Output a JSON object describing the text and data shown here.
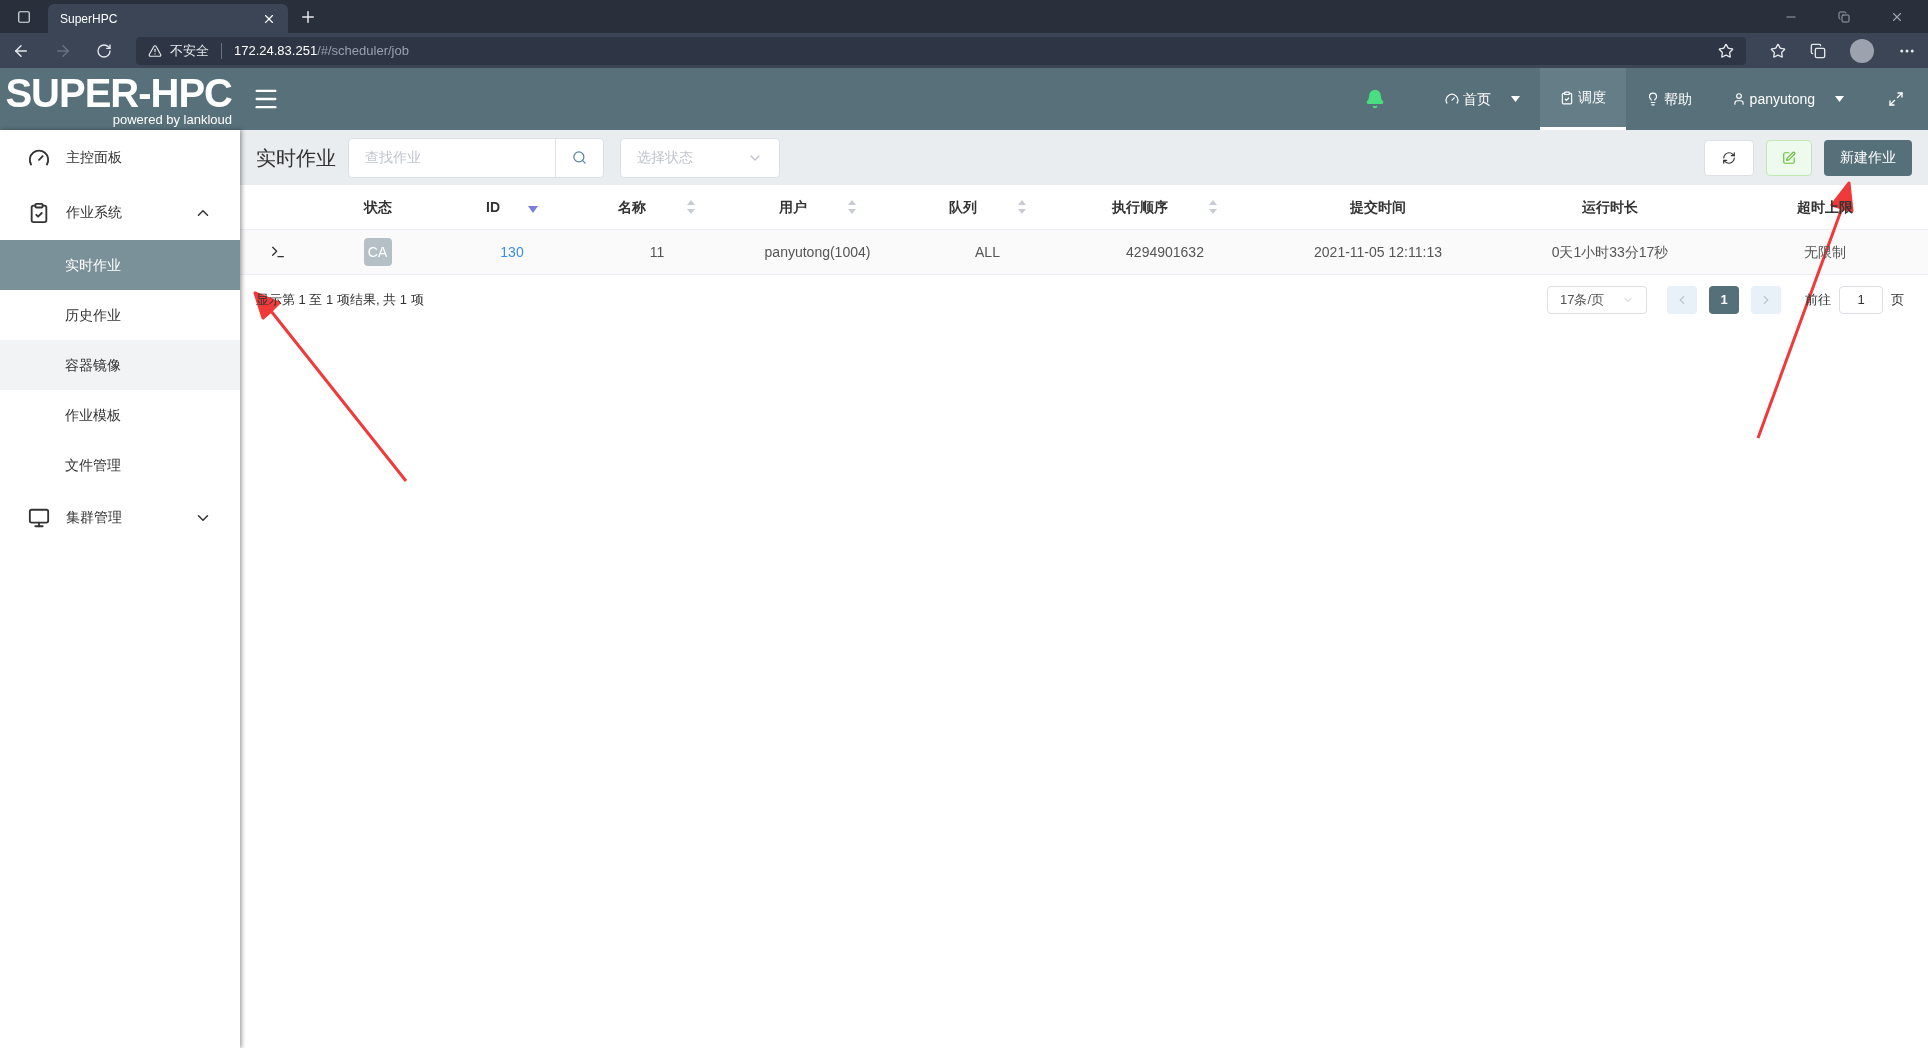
{
  "browser": {
    "tab_title": "SuperHPC",
    "security_label": "不安全",
    "url_host": "172.24.83.251",
    "url_path": "/#/scheduler/job"
  },
  "header": {
    "logo": "SUPER-HPC",
    "logo_sub": "powered by lankloud",
    "nav": [
      {
        "kind": "home",
        "label": "首页",
        "dropdown": true,
        "selected": false
      },
      {
        "kind": "schedule",
        "label": "调度",
        "dropdown": false,
        "selected": true
      },
      {
        "kind": "help",
        "label": "帮助",
        "dropdown": false,
        "selected": false
      },
      {
        "kind": "user",
        "label": "panyutong",
        "dropdown": true,
        "selected": false
      }
    ]
  },
  "sidebar": {
    "items": [
      {
        "kind": "dashboard",
        "label": "主控面板"
      },
      {
        "kind": "jobs",
        "label": "作业系统",
        "expanded": true,
        "children": [
          {
            "label": "实时作业",
            "selected": true,
            "hovered": false
          },
          {
            "label": "历史作业",
            "selected": false,
            "hovered": false
          },
          {
            "label": "容器镜像",
            "selected": false,
            "hovered": true
          },
          {
            "label": "作业模板",
            "selected": false,
            "hovered": false
          },
          {
            "label": "文件管理",
            "selected": false,
            "hovered": false
          }
        ]
      },
      {
        "kind": "cluster",
        "label": "集群管理",
        "expanded": false
      }
    ]
  },
  "toolbar": {
    "title": "实时作业",
    "search": {
      "placeholder": "查找作业"
    },
    "status_select": {
      "placeholder": "选择状态"
    },
    "new_button": "新建作业"
  },
  "table": {
    "columns": [
      {
        "label": "状态",
        "sortable": false
      },
      {
        "label": "ID",
        "sortable": true,
        "sorted_desc": true
      },
      {
        "label": "名称",
        "sortable": true,
        "sorted_desc": false
      },
      {
        "label": "用户",
        "sortable": true,
        "sorted_desc": false
      },
      {
        "label": "队列",
        "sortable": true,
        "sorted_desc": false
      },
      {
        "label": "执行顺序",
        "sortable": true,
        "sorted_desc": false
      },
      {
        "label": "提交时间",
        "sortable": false
      },
      {
        "label": "运行时长",
        "sortable": false
      },
      {
        "label": "超时上限",
        "sortable": false
      }
    ],
    "rows": [
      {
        "status": "CA",
        "id": "130",
        "name": "11",
        "user": "panyutong(1004)",
        "queue": "ALL",
        "order": "4294901632",
        "submitted": "2021-11-05 12:11:13",
        "runtime": "0天1小时33分17秒",
        "timeout": "无限制"
      }
    ]
  },
  "summary": "显示第 1 至 1 项结果, 共 1 项",
  "pagination": {
    "page_size": "17条/页",
    "pages": [
      {
        "label": "1",
        "selected": true
      }
    ],
    "goto_label": "前往",
    "goto_value": "1",
    "page_unit": "页"
  }
}
